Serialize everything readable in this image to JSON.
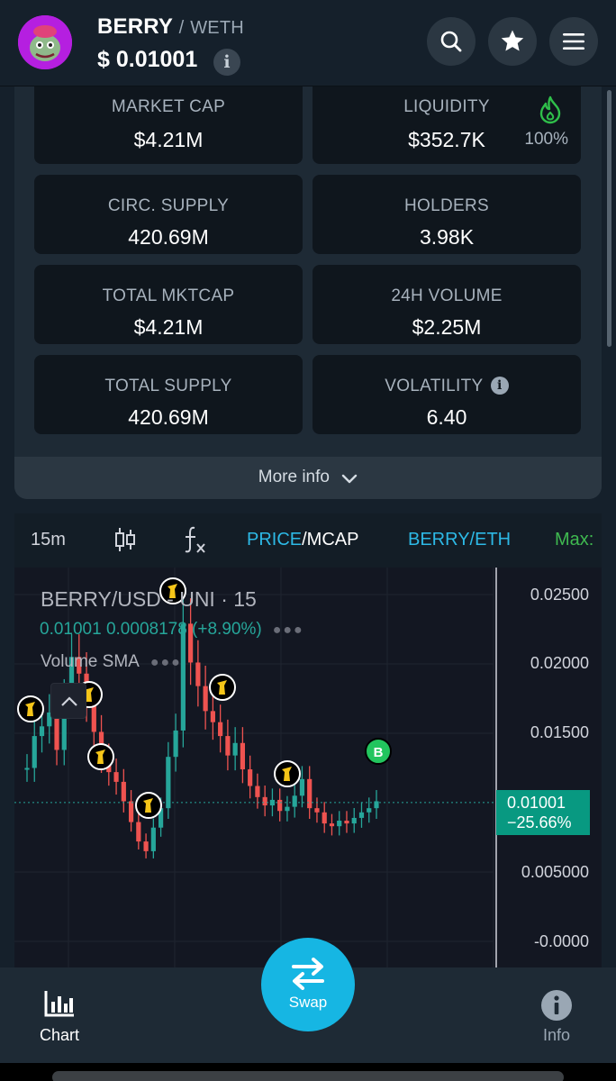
{
  "header": {
    "token": "BERRY",
    "pair": "WETH",
    "price": "$ 0.01001",
    "info_icon": "i"
  },
  "stats": {
    "market_cap": {
      "label": "MARKET CAP",
      "value": "$4.21M"
    },
    "liquidity": {
      "label": "LIQUIDITY",
      "value": "$352.7K",
      "percent": "100%"
    },
    "circ_supply": {
      "label": "CIRC. SUPPLY",
      "value": "420.69M"
    },
    "holders": {
      "label": "HOLDERS",
      "value": "3.98K"
    },
    "total_mktcap": {
      "label": "TOTAL MKTCAP",
      "value": "$4.21M"
    },
    "volume_24h": {
      "label": "24H VOLUME",
      "value": "$2.25M"
    },
    "total_supply": {
      "label": "TOTAL SUPPLY",
      "value": "420.69M"
    },
    "volatility": {
      "label": "VOLATILITY",
      "value": "6.40"
    },
    "more_info": "More info"
  },
  "chart_toolbar": {
    "interval": "15m",
    "price_label": "PRICE",
    "mcap_label": "/MCAP",
    "pair_label": "BERRY/ETH",
    "max_label": "Max:"
  },
  "chart": {
    "title": "BERRY/USD - UNI · 15",
    "ohlc": "0.01001  0.0008178 (+8.90%)",
    "volume_label": "Volume SMA",
    "last_price": "0.01001",
    "last_change": "−25.66%",
    "buy_marker": "B",
    "y_ticks": [
      "0.02500",
      "0.02000",
      "0.01500",
      "0.005000",
      "-0.0000"
    ]
  },
  "chart_data": {
    "type": "line",
    "title": "BERRY/USD - UNI · 15",
    "xlabel": "",
    "ylabel": "",
    "ylim": [
      0,
      0.027
    ],
    "y_ticks": [
      0.025,
      0.02,
      0.015,
      0.005,
      0.0
    ],
    "series": [
      {
        "values": [
          0.0125,
          0.0148,
          0.0155,
          0.0165,
          0.0138,
          0.0175,
          0.0205,
          0.0193,
          0.0172,
          0.0151,
          0.0132,
          0.0122,
          0.0115,
          0.0101,
          0.0086,
          0.0072,
          0.0065,
          0.0082,
          0.0096,
          0.0133,
          0.0152,
          0.0229,
          0.0201,
          0.0184,
          0.0166,
          0.0158,
          0.0148,
          0.0134,
          0.0143,
          0.0124,
          0.0112,
          0.0104,
          0.0098,
          0.0102,
          0.0094,
          0.0097,
          0.0105,
          0.0117,
          0.0096,
          0.0093,
          0.0085,
          0.0083,
          0.0087,
          0.0085,
          0.0089,
          0.0093,
          0.0096,
          0.0101
        ]
      }
    ],
    "last_value": 0.01001,
    "last_change": "−25.66%"
  },
  "nav": {
    "chart": "Chart",
    "swap": "Swap",
    "info": "Info"
  },
  "colors": {
    "background": "#15202b",
    "accent": "#16b6e3",
    "up": "#26a69a",
    "down": "#ef5350",
    "toolbar_link": "#2db9e6",
    "max_green": "#3fb950"
  }
}
